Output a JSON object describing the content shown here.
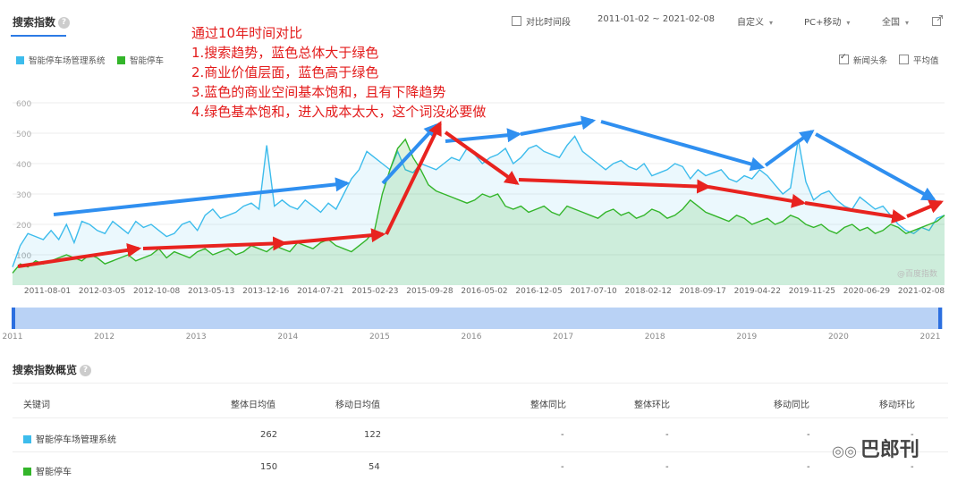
{
  "header": {
    "title": "搜索指数",
    "help": "?",
    "compare_period": "对比时间段",
    "date_range": "2011-01-02 ~ 2021-02-08",
    "custom": "自定义",
    "device": "PC+移动",
    "region": "全国",
    "caret": "▾"
  },
  "legend": {
    "news_headline": "新闻头条",
    "average": "平均值"
  },
  "annotation": {
    "lines": [
      "通过10年时间对比",
      "1.搜索趋势，蓝色总体大于绿色",
      "2.商业价值层面，蓝色高于绿色",
      "3.蓝色的商业空间基本饱和，且有下降趋势",
      "4.绿色基本饱和，进入成本太大，这个词没必要做"
    ]
  },
  "watermark_chart": "@百度指数",
  "colors": {
    "blue": "#3dbcec",
    "green": "#33b52a",
    "arrow_blue": "#2f8ff0",
    "arrow_red": "#e8231f"
  },
  "chart_data": {
    "type": "line",
    "ylim": [
      0,
      600
    ],
    "yticks": [
      100,
      200,
      300,
      400,
      500,
      600
    ],
    "x_tick_labels": [
      "2011-08-01",
      "2012-03-05",
      "2012-10-08",
      "2013-05-13",
      "2013-12-16",
      "2014-07-21",
      "2015-02-23",
      "2015-09-28",
      "2016-05-02",
      "2016-12-05",
      "2017-07-10",
      "2018-02-12",
      "2018-09-17",
      "2019-04-22",
      "2019-11-25",
      "2020-06-29",
      "2021-02-08"
    ],
    "year_labels": [
      "2011",
      "2012",
      "2013",
      "2014",
      "2015",
      "2016",
      "2017",
      "2018",
      "2019",
      "2020",
      "2021"
    ],
    "series": [
      {
        "name": "智能停车场管理系统",
        "color": "#3dbcec",
        "values": [
          60,
          130,
          170,
          160,
          150,
          180,
          150,
          200,
          140,
          210,
          200,
          180,
          170,
          210,
          190,
          170,
          210,
          190,
          200,
          180,
          160,
          170,
          200,
          210,
          180,
          230,
          250,
          220,
          230,
          240,
          260,
          270,
          250,
          460,
          260,
          280,
          260,
          250,
          280,
          260,
          240,
          270,
          250,
          300,
          350,
          380,
          440,
          420,
          400,
          380,
          440,
          380,
          370,
          400,
          390,
          380,
          400,
          420,
          410,
          450,
          430,
          400,
          420,
          430,
          450,
          400,
          420,
          450,
          460,
          440,
          430,
          420,
          460,
          490,
          440,
          420,
          400,
          380,
          400,
          410,
          390,
          380,
          400,
          360,
          370,
          380,
          400,
          390,
          350,
          380,
          360,
          370,
          380,
          350,
          340,
          360,
          350,
          380,
          360,
          330,
          300,
          320,
          480,
          340,
          280,
          300,
          310,
          280,
          260,
          250,
          290,
          270,
          250,
          260,
          230,
          200,
          180,
          170,
          190,
          180,
          220,
          230
        ]
      },
      {
        "name": "智能停车",
        "color": "#33b52a",
        "values": [
          40,
          70,
          60,
          80,
          70,
          80,
          90,
          100,
          90,
          80,
          100,
          90,
          70,
          80,
          90,
          100,
          80,
          90,
          100,
          120,
          90,
          110,
          100,
          90,
          110,
          120,
          100,
          110,
          120,
          100,
          110,
          130,
          120,
          110,
          130,
          120,
          110,
          140,
          130,
          120,
          140,
          150,
          130,
          120,
          110,
          130,
          150,
          180,
          300,
          380,
          450,
          480,
          420,
          380,
          330,
          310,
          300,
          290,
          280,
          270,
          280,
          300,
          290,
          300,
          260,
          250,
          260,
          240,
          250,
          260,
          240,
          230,
          260,
          250,
          240,
          230,
          220,
          240,
          250,
          230,
          240,
          220,
          230,
          250,
          240,
          220,
          230,
          250,
          280,
          260,
          240,
          230,
          220,
          210,
          230,
          220,
          200,
          210,
          220,
          200,
          210,
          230,
          220,
          200,
          190,
          200,
          180,
          170,
          190,
          200,
          180,
          190,
          170,
          180,
          200,
          190,
          170,
          180,
          190,
          200,
          210,
          230
        ]
      }
    ]
  },
  "overview": {
    "title": "搜索指数概览",
    "columns": [
      "关键词",
      "整体日均值",
      "移动日均值",
      "整体同比",
      "整体环比",
      "移动同比",
      "移动环比"
    ],
    "rows": [
      {
        "keyword": "智能停车场管理系统",
        "overall": "262",
        "mobile": "122",
        "yoy": "-",
        "mom": "-",
        "m_yoy": "-",
        "m_mom": "-",
        "color": "#3dbcec"
      },
      {
        "keyword": "智能停车",
        "overall": "150",
        "mobile": "54",
        "yoy": "-",
        "mom": "-",
        "m_yoy": "-",
        "m_mom": "-",
        "color": "#33b52a"
      }
    ]
  },
  "watermark_brand": "巴郎刊"
}
